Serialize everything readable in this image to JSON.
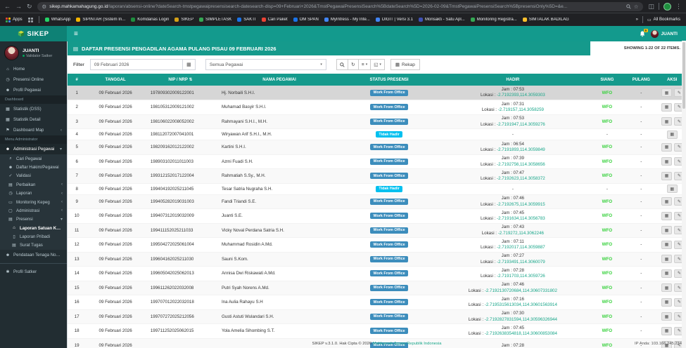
{
  "browser": {
    "url_domain": "sikep.mahkamahagung.go.id",
    "url_path": "/laporan/absensi-online?dateSearch-tmstpegawaipresensisearch-datesearch-disp=09+Februari+2026&TmstPegawaiPresensiSearch%5BdateSearch%5D=2026-02-09&TmstPegawaiPresensiSearch%5BpresensiOnly%5D=&e...",
    "apps_label": "Apps",
    "bookmarks": [
      {
        "label": "WhatsApp",
        "color": "#25d366"
      },
      {
        "label": "SIPINTAR (Sistem In...",
        "color": "#f4b400"
      },
      {
        "label": "Komdanas Login",
        "color": "#1e8e3e"
      },
      {
        "label": "SIKEP",
        "color": "#d4a017"
      },
      {
        "label": "SIMPLETASK",
        "color": "#34a853"
      },
      {
        "label": "SAKTI",
        "color": "#1a73e8"
      },
      {
        "label": "Cari Paket",
        "color": "#ea4335"
      },
      {
        "label": "OM SPAN",
        "color": "#1a73e8"
      },
      {
        "label": "MyIntress - My Inte...",
        "color": "#4285f4"
      },
      {
        "label": "DIGIT | Versi 3.1",
        "color": "#4285f4"
      },
      {
        "label": "Monsakti - Satu Apl...",
        "color": "#3f51b5"
      },
      {
        "label": "Monitoring Registra...",
        "color": "#34a853"
      },
      {
        "label": "SIMTALAK BADILAG",
        "color": "#fbc02d"
      }
    ],
    "overflow_chevron": "»",
    "all_bookmarks_label": "All Bookmarks"
  },
  "appbar": {
    "brand": "SIKEP",
    "hamburger_icon": "menu-icon",
    "notification_badge": "9",
    "user": "JUANTI"
  },
  "sidebar": {
    "user": {
      "name": "JUANTI",
      "role": "Validator Satker"
    },
    "items": [
      {
        "type": "item",
        "label": "Home",
        "icon": "home-icon"
      },
      {
        "type": "item",
        "label": "Presensi Online",
        "icon": "clock-icon"
      },
      {
        "type": "item",
        "label": "Profil Pegawai",
        "icon": "user-icon"
      },
      {
        "type": "section",
        "label": "Dashboard"
      },
      {
        "type": "item",
        "label": "Statistik (DSS)",
        "icon": "chart-icon"
      },
      {
        "type": "item",
        "label": "Statistik Detail",
        "icon": "chart-icon"
      },
      {
        "type": "item",
        "label": "Dashboard Map",
        "icon": "flag-icon",
        "chevron": "left"
      },
      {
        "type": "section",
        "label": "Menu Administrator"
      },
      {
        "type": "item",
        "label": "Administrasi Pegawai",
        "icon": "users-icon",
        "chevron": "down",
        "active": true
      },
      {
        "type": "sub",
        "label": "Cari Pegawai",
        "icon": "search-icon"
      },
      {
        "type": "sub",
        "label": "Daftar Hakim/Pegawai",
        "icon": "users-icon"
      },
      {
        "type": "sub",
        "label": "Validasi",
        "icon": "check-icon"
      },
      {
        "type": "sub",
        "label": "Perbaikan",
        "icon": "calendar-icon",
        "chevron": "left"
      },
      {
        "type": "sub",
        "label": "Laporan",
        "icon": "clock-icon",
        "chevron": "left"
      },
      {
        "type": "sub",
        "label": "Monitoring Kepeg",
        "icon": "monitor-icon",
        "chevron": "left"
      },
      {
        "type": "sub",
        "label": "Administrasi",
        "icon": "box-icon",
        "chevron": "left"
      },
      {
        "type": "sub",
        "label": "Presensi",
        "icon": "calendar-icon",
        "chevron": "down"
      },
      {
        "type": "subsub",
        "label": "Laporan Satuan Kerja",
        "icon": "bank-icon",
        "active": true
      },
      {
        "type": "subsub",
        "label": "Laporan Pribadi",
        "icon": "id-icon"
      },
      {
        "type": "subsub",
        "label": "Surat Tugas",
        "icon": "file-icon"
      },
      {
        "type": "item",
        "label": "Pendataan Tenaga Non ASN",
        "icon": "users-icon"
      },
      {
        "type": "divider"
      },
      {
        "type": "item",
        "label": "Profil Satker",
        "icon": "gear-icon"
      }
    ]
  },
  "panel": {
    "title": "DAFTAR PRESENSI PENGADILAN AGAMA PULANG PISAU 09 FEBRUARI 2026",
    "showing": "SHOWING 1-22 OF 22 ITEMS."
  },
  "filter": {
    "label": "Filter",
    "date_value": "09 Februari 2026",
    "select_value": "Semua Pegawai",
    "rekap_label": "Rekap"
  },
  "table": {
    "headers": [
      "#",
      "TANGGAL",
      "NIP / NRP",
      "NAMA PEGAWAI",
      "STATUS PRESENSI",
      "HADIR",
      "SIANG",
      "PULANG",
      "AKSI"
    ],
    "jam_prefix": "Jam : ",
    "lokasi_prefix": "Lokasi : ",
    "rows": [
      {
        "no": 1,
        "tanggal": "09 Februari 2026",
        "nip": "197809302009122001",
        "nama": "Hj. Norbaili S.H.I.",
        "status": "Work From Office",
        "status_type": "wfo",
        "jam": "07:53",
        "lokasi": "-2.7192393,114.3059303",
        "siang": "WFO",
        "pulang": "-",
        "selected": true
      },
      {
        "no": 2,
        "tanggal": "09 Februari 2026",
        "nip": "198105312009121002",
        "nama": "Muhamad Basyir S.H.I.",
        "status": "Work From Office",
        "status_type": "wfo",
        "jam": "07:31",
        "lokasi": "-2.719157,114.3058259",
        "siang": "WFO",
        "pulang": "-"
      },
      {
        "no": 3,
        "tanggal": "09 Februari 2026",
        "nip": "198106022008052002",
        "nama": "Rahmayani S.H.I., M.H.",
        "status": "Work From Office",
        "status_type": "wfo",
        "jam": "07:53",
        "lokasi": "-2.7191947,114.3059276",
        "siang": "WFO",
        "pulang": "-"
      },
      {
        "no": 4,
        "tanggal": "09 Februari 2026",
        "nip": "198112072007041001",
        "nama": "Wiryawan Arif S.H.I., M.H.",
        "status": "Tidak Hadir",
        "status_type": "absent",
        "jam": "",
        "lokasi": "",
        "siang": "-",
        "pulang": "-"
      },
      {
        "no": 5,
        "tanggal": "09 Februari 2026",
        "nip": "198209162012122002",
        "nama": "Kartini S.H.I.",
        "status": "Work From Office",
        "status_type": "wfo",
        "jam": "06:54",
        "lokasi": "-2.7191893,114.3059849",
        "siang": "WFO",
        "pulang": "-"
      },
      {
        "no": 6,
        "tanggal": "09 Februari 2026",
        "nip": "198903102011011003",
        "nama": "Azmi Fuadi S.H.",
        "status": "Work From Office",
        "status_type": "wfo",
        "jam": "07:39",
        "lokasi": "-2.7192756,114.3058656",
        "siang": "WFO",
        "pulang": "-"
      },
      {
        "no": 7,
        "tanggal": "09 Februari 2026",
        "nip": "199312152017122004",
        "nama": "Rahmatiah S.Sy., M.H.",
        "status": "Work From Office",
        "status_type": "wfo",
        "jam": "07:47",
        "lokasi": "-2.7192623,114.3058372",
        "siang": "WFO",
        "pulang": "-"
      },
      {
        "no": 8,
        "tanggal": "09 Februari 2026",
        "nip": "199404192025211045",
        "nama": "Tesar Satria Nugraha S.H.",
        "status": "Tidak Hadir",
        "status_type": "absent",
        "jam": "",
        "lokasi": "",
        "siang": "-",
        "pulang": "-"
      },
      {
        "no": 9,
        "tanggal": "09 Februari 2026",
        "nip": "199405282019031003",
        "nama": "Fandi Triandi S.E.",
        "status": "Work From Office",
        "status_type": "wfo",
        "jam": "07:46",
        "lokasi": "-2.7192675,114.3059915",
        "siang": "WFO",
        "pulang": "-"
      },
      {
        "no": 10,
        "tanggal": "09 Februari 2026",
        "nip": "199407312019032009",
        "nama": "Juanti S.E.",
        "status": "Work From Office",
        "status_type": "wfo",
        "jam": "07:45",
        "lokasi": "-2.7191634,114.3056783",
        "siang": "WFO",
        "pulang": "-"
      },
      {
        "no": 11,
        "tanggal": "09 Februari 2026",
        "nip": "199411152025211033",
        "nama": "Vicky Noval Perdana Satria S.H.",
        "status": "Work From Office",
        "status_type": "wfo",
        "jam": "07:43",
        "lokasi": "-2.719272,114.3062246",
        "siang": "WFO",
        "pulang": "-"
      },
      {
        "no": 12,
        "tanggal": "09 Februari 2026",
        "nip": "199504272025061004",
        "nama": "Muhammad Rosidin A.Md.",
        "status": "Work From Office",
        "status_type": "wfo",
        "jam": "07:11",
        "lokasi": "-2.7192017,114.3059887",
        "siang": "WFO",
        "pulang": "-"
      },
      {
        "no": 13,
        "tanggal": "09 Februari 2026",
        "nip": "199604162025211030",
        "nama": "Sauni S.Kom.",
        "status": "Work From Office",
        "status_type": "wfo",
        "jam": "07:27",
        "lokasi": "-2.7193491,114.3060079",
        "siang": "WFO",
        "pulang": "-"
      },
      {
        "no": 14,
        "tanggal": "09 Februari 2026",
        "nip": "199605042025062013",
        "nama": "Annisa Dwi Riskawati A.Md.",
        "status": "Work From Office",
        "status_type": "wfo",
        "jam": "07:28",
        "lokasi": "-2.7191703,114.3059726",
        "siang": "WFO",
        "pulang": "-"
      },
      {
        "no": 15,
        "tanggal": "09 Februari 2026",
        "nip": "199611262022032008",
        "nama": "Putri Syah Norens A.Md.",
        "status": "Work From Office",
        "status_type": "wfo",
        "jam": "07:46",
        "lokasi": "-2.7192130720684,114.30607331802",
        "siang": "WFO",
        "pulang": "-"
      },
      {
        "no": 16,
        "tanggal": "09 Februari 2026",
        "nip": "199707012022032018",
        "nama": "Ina Aulia Rahayu S.H",
        "status": "Work From Office",
        "status_type": "wfo",
        "jam": "07:16",
        "lokasi": "-2.7195315613034,114.30601563914",
        "siang": "WFO",
        "pulang": "-"
      },
      {
        "no": 17,
        "tanggal": "09 Februari 2026",
        "nip": "199707272025212056",
        "nama": "Gusti Astuti Wulandari S.H.",
        "status": "Work From Office",
        "status_type": "wfo",
        "jam": "07:30",
        "lokasi": "-2.7192827831594,114.30596326944",
        "siang": "WFO",
        "pulang": "-"
      },
      {
        "no": 18,
        "tanggal": "09 Februari 2026",
        "nip": "199711252025062015",
        "nama": "Yola Amelia Sihombing S.T.",
        "status": "Work From Office",
        "status_type": "wfo",
        "jam": "07:45",
        "lokasi": "-2.7192638354818,114.30600853084",
        "siang": "WFO",
        "pulang": "-"
      },
      {
        "no": 19,
        "tanggal": "09 Februari 2026",
        "nip": "",
        "nama": "",
        "status": "Work From Office",
        "status_type": "wfo",
        "jam": "07:28",
        "lokasi": "",
        "siang": "WFO",
        "pulang": "-"
      }
    ]
  },
  "footer": {
    "version": "SIKEP v.3.1.0. Hak Cipta © 2026 ",
    "link": "Mahkamah Agung Republik Indonesia",
    "ip": "IP Anda: 103.166.245.234"
  },
  "colors": {
    "teal_header": "#159a8c",
    "brand_teal_dark": "#0e8175",
    "sidebar_bg": "#222d32",
    "badge_wfo": "#3c8dbc",
    "badge_absent": "#00c0ef",
    "wfo_green": "#35d13a",
    "lokasi_link": "#18a689"
  }
}
